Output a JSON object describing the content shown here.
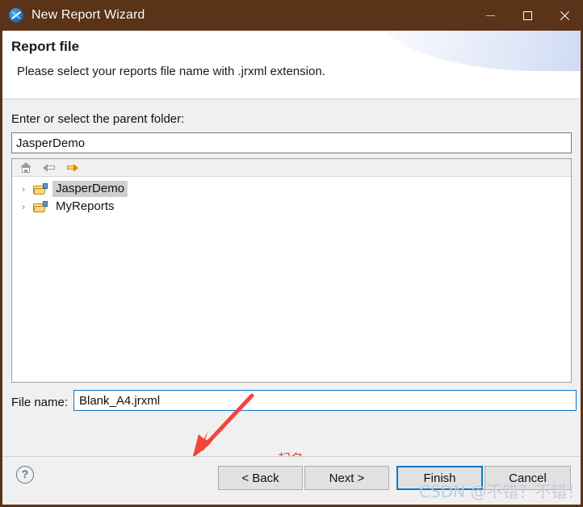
{
  "window": {
    "title": "New Report Wizard",
    "icon": "jaspersoft-compass-icon",
    "titlebar_color": "#5a3318",
    "controls": {
      "minimize": "minimize-icon",
      "maximize": "maximize-icon",
      "close": "close-icon"
    }
  },
  "header": {
    "title": "Report file",
    "description": "Please select your reports file name with .jrxml extension."
  },
  "form": {
    "parent_folder_label": "Enter or select the parent folder:",
    "parent_folder_value": "JasperDemo",
    "parent_folder_placeholder": "",
    "file_name_label": "File name:",
    "file_name_value": "Blank_A4.jrxml",
    "file_name_placeholder": "",
    "focus_border_color": "#0a78c8"
  },
  "tree": {
    "toolbar": [
      {
        "name": "home-icon",
        "label": "Home"
      },
      {
        "name": "back-arrow-icon",
        "label": "Back"
      },
      {
        "name": "forward-arrow-icon",
        "label": "Forward"
      }
    ],
    "items": [
      {
        "label": "JasperDemo",
        "selected": true,
        "twisty": "›"
      },
      {
        "label": "MyReports",
        "selected": false,
        "twisty": "›"
      }
    ]
  },
  "annotations": {
    "arrow": "red-arrow",
    "text": "起名",
    "box": "red-highlight-box",
    "color": "#ef2a1f"
  },
  "footer": {
    "help_label": "?",
    "buttons": [
      {
        "name": "back-button",
        "label": "< Back",
        "default": false
      },
      {
        "name": "next-button",
        "label": "Next >",
        "default": false
      },
      {
        "name": "finish-button",
        "label": "Finish",
        "default": true
      },
      {
        "name": "cancel-button",
        "label": "Cancel",
        "default": false
      }
    ]
  },
  "watermark": "CSDN @不错？不错！"
}
